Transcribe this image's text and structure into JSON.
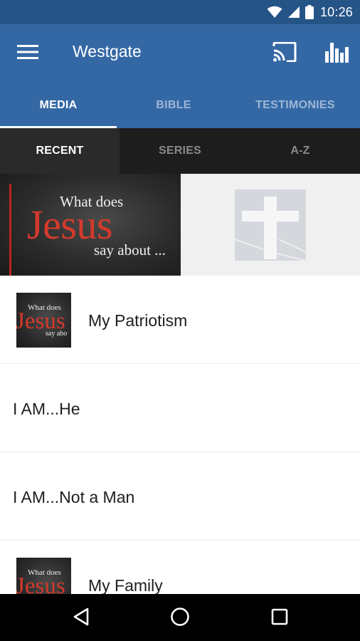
{
  "status_bar": {
    "time": "10:26",
    "icons": [
      "wifi-icon",
      "signal-icon",
      "battery-icon"
    ]
  },
  "app_bar": {
    "title": "Westgate",
    "icons": [
      "menu-icon",
      "cast-icon",
      "stats-icon"
    ],
    "color": "#3468a5"
  },
  "main_tabs": [
    {
      "label": "MEDIA",
      "active": true
    },
    {
      "label": "BIBLE",
      "active": false
    },
    {
      "label": "TESTIMONIES",
      "active": false
    }
  ],
  "sub_tabs": [
    {
      "label": "RECENT",
      "active": true
    },
    {
      "label": "SERIES",
      "active": false
    },
    {
      "label": "A-Z",
      "active": false
    }
  ],
  "banner": {
    "line1": "What does",
    "line2": "Jesus",
    "line3": "say about ..."
  },
  "thumbnail": {
    "line1": "What does",
    "line2": "Jesus",
    "line3": "say abo"
  },
  "media_items": [
    {
      "title": "My Patriotism",
      "has_thumbnail": true
    },
    {
      "title": "I AM...He",
      "has_thumbnail": false
    },
    {
      "title": "I AM...Not a Man",
      "has_thumbnail": false
    },
    {
      "title": "My Family",
      "has_thumbnail": true
    }
  ],
  "nav_bar": {
    "icons": [
      "back-icon",
      "home-icon",
      "recents-icon"
    ]
  }
}
